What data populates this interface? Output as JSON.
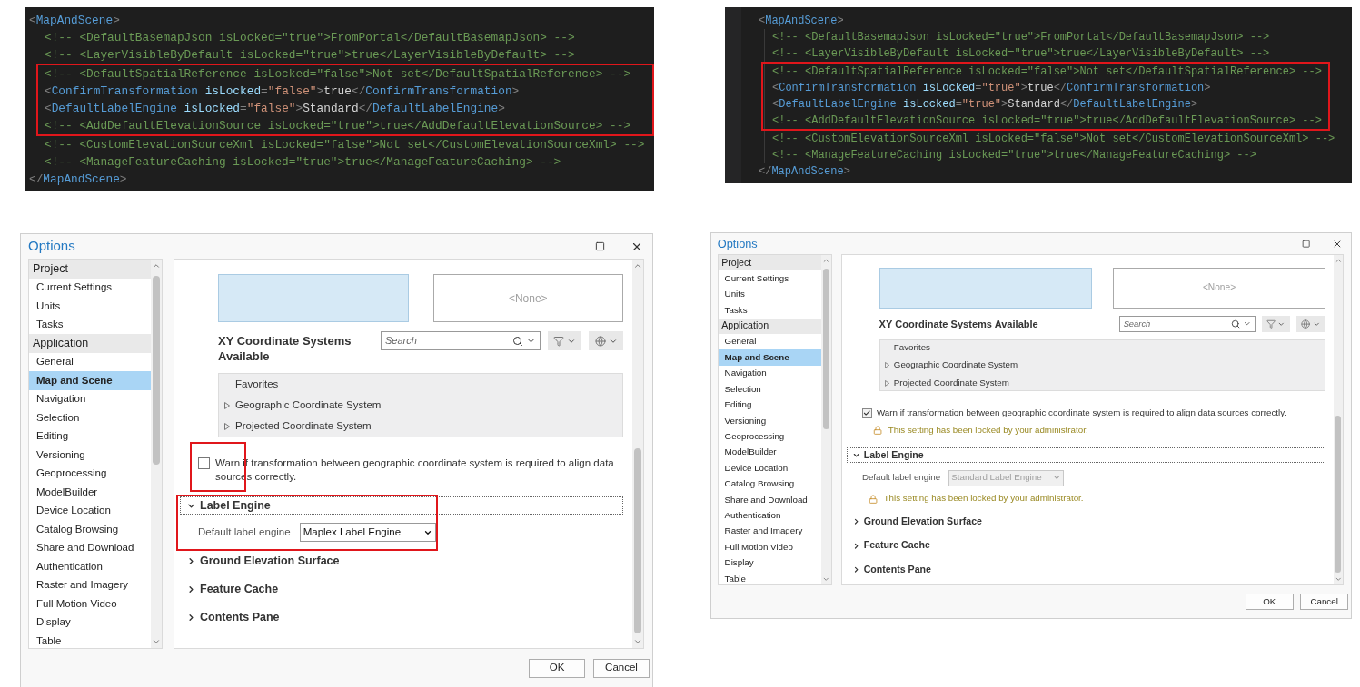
{
  "code_panels": [
    {
      "open": [
        {
          "kind": "punct",
          "text": "<"
        },
        {
          "kind": "tag",
          "text": "MapAndScene"
        },
        {
          "kind": "punct",
          "text": ">"
        }
      ],
      "children": [
        {
          "highlighted": false,
          "tokens": [
            {
              "kind": "comment",
              "text": "<!-- <DefaultBasemapJson isLocked=\"true\">FromPortal</DefaultBasemapJson> -->"
            }
          ]
        },
        {
          "highlighted": false,
          "tokens": [
            {
              "kind": "comment",
              "text": "<!-- <LayerVisibleByDefault isLocked=\"true\">true</LayerVisibleByDefault> -->"
            }
          ]
        },
        {
          "highlighted": true,
          "tokens": [
            {
              "kind": "comment",
              "text": "<!-- <DefaultSpatialReference isLocked=\"false\">Not set</DefaultSpatialReference> -->"
            }
          ]
        },
        {
          "highlighted": true,
          "tokens": [
            {
              "kind": "punct",
              "text": "<"
            },
            {
              "kind": "tag",
              "text": "ConfirmTransformation"
            },
            {
              "kind": "attr",
              "text": " isLocked"
            },
            {
              "kind": "punct",
              "text": "="
            },
            {
              "kind": "string",
              "text": "\"false\""
            },
            {
              "kind": "punct",
              "text": ">"
            },
            {
              "kind": "content",
              "text": "true"
            },
            {
              "kind": "punct",
              "text": "</"
            },
            {
              "kind": "tag",
              "text": "ConfirmTransformation"
            },
            {
              "kind": "punct",
              "text": ">"
            }
          ]
        },
        {
          "highlighted": true,
          "tokens": [
            {
              "kind": "punct",
              "text": "<"
            },
            {
              "kind": "tag",
              "text": "DefaultLabelEngine"
            },
            {
              "kind": "attr",
              "text": " isLocked"
            },
            {
              "kind": "punct",
              "text": "="
            },
            {
              "kind": "string",
              "text": "\"false\""
            },
            {
              "kind": "punct",
              "text": ">"
            },
            {
              "kind": "content",
              "text": "Standard"
            },
            {
              "kind": "punct",
              "text": "</"
            },
            {
              "kind": "tag",
              "text": "DefaultLabelEngine"
            },
            {
              "kind": "punct",
              "text": ">"
            }
          ]
        },
        {
          "highlighted": true,
          "tokens": [
            {
              "kind": "comment",
              "text": "<!-- <AddDefaultElevationSource isLocked=\"true\">true</AddDefaultElevationSource> -->"
            }
          ]
        },
        {
          "highlighted": false,
          "tokens": [
            {
              "kind": "comment",
              "text": "<!-- <CustomElevationSourceXml isLocked=\"false\">Not set</CustomElevationSourceXml> -->"
            }
          ]
        },
        {
          "highlighted": false,
          "tokens": [
            {
              "kind": "comment",
              "text": "<!-- <ManageFeatureCaching isLocked=\"true\">true</ManageFeatureCaching> -->"
            }
          ]
        }
      ],
      "close": [
        {
          "kind": "punct",
          "text": "</"
        },
        {
          "kind": "tag",
          "text": "MapAndScene"
        },
        {
          "kind": "punct",
          "text": ">"
        }
      ]
    },
    {
      "open": [
        {
          "kind": "punct",
          "text": "<"
        },
        {
          "kind": "tag",
          "text": "MapAndScene"
        },
        {
          "kind": "punct",
          "text": ">"
        }
      ],
      "children": [
        {
          "highlighted": false,
          "tokens": [
            {
              "kind": "comment",
              "text": "<!-- <DefaultBasemapJson isLocked=\"true\">FromPortal</DefaultBasemapJson> -->"
            }
          ]
        },
        {
          "highlighted": false,
          "tokens": [
            {
              "kind": "comment",
              "text": "<!-- <LayerVisibleByDefault isLocked=\"true\">true</LayerVisibleByDefault> -->"
            }
          ]
        },
        {
          "highlighted": true,
          "tokens": [
            {
              "kind": "comment",
              "text": "<!-- <DefaultSpatialReference isLocked=\"false\">Not set</DefaultSpatialReference> -->"
            }
          ]
        },
        {
          "highlighted": true,
          "tokens": [
            {
              "kind": "punct",
              "text": "<"
            },
            {
              "kind": "tag",
              "text": "ConfirmTransformation"
            },
            {
              "kind": "attr",
              "text": " isLocked"
            },
            {
              "kind": "punct",
              "text": "="
            },
            {
              "kind": "string",
              "text": "\"true\""
            },
            {
              "kind": "punct",
              "text": ">"
            },
            {
              "kind": "content",
              "text": "true"
            },
            {
              "kind": "punct",
              "text": "</"
            },
            {
              "kind": "tag",
              "text": "ConfirmTransformation"
            },
            {
              "kind": "punct",
              "text": ">"
            }
          ]
        },
        {
          "highlighted": true,
          "tokens": [
            {
              "kind": "punct",
              "text": "<"
            },
            {
              "kind": "tag",
              "text": "DefaultLabelEngine"
            },
            {
              "kind": "attr",
              "text": " isLocked"
            },
            {
              "kind": "punct",
              "text": "="
            },
            {
              "kind": "string",
              "text": "\"true\""
            },
            {
              "kind": "punct",
              "text": ">"
            },
            {
              "kind": "content",
              "text": "Standard"
            },
            {
              "kind": "punct",
              "text": "</"
            },
            {
              "kind": "tag",
              "text": "DefaultLabelEngine"
            },
            {
              "kind": "punct",
              "text": ">"
            }
          ]
        },
        {
          "highlighted": true,
          "tokens": [
            {
              "kind": "comment",
              "text": "<!-- <AddDefaultElevationSource isLocked=\"true\">true</AddDefaultElevationSource> -->"
            }
          ]
        },
        {
          "highlighted": false,
          "tokens": [
            {
              "kind": "comment",
              "text": "<!-- <CustomElevationSourceXml isLocked=\"false\">Not set</CustomElevationSourceXml> -->"
            }
          ]
        },
        {
          "highlighted": false,
          "tokens": [
            {
              "kind": "comment",
              "text": "<!-- <ManageFeatureCaching isLocked=\"true\">true</ManageFeatureCaching> -->"
            }
          ]
        }
      ],
      "close": [
        {
          "kind": "punct",
          "text": "</"
        },
        {
          "kind": "tag",
          "text": "MapAndScene"
        },
        {
          "kind": "punct",
          "text": ">"
        }
      ]
    }
  ],
  "dialogs": [
    {
      "title": "Options",
      "sidebar": [
        {
          "heading": "Project",
          "items": [
            {
              "label": "Current Settings",
              "selected": false
            },
            {
              "label": "Units",
              "selected": false
            },
            {
              "label": "Tasks",
              "selected": false
            }
          ]
        },
        {
          "heading": "Application",
          "items": [
            {
              "label": "General",
              "selected": false
            },
            {
              "label": "Map and Scene",
              "selected": true
            },
            {
              "label": "Navigation",
              "selected": false
            },
            {
              "label": "Selection",
              "selected": false
            },
            {
              "label": "Editing",
              "selected": false
            },
            {
              "label": "Versioning",
              "selected": false
            },
            {
              "label": "Geoprocessing",
              "selected": false
            },
            {
              "label": "ModelBuilder",
              "selected": false
            },
            {
              "label": "Device Location",
              "selected": false
            },
            {
              "label": "Catalog Browsing",
              "selected": false
            },
            {
              "label": "Share and Download",
              "selected": false
            },
            {
              "label": "Authentication",
              "selected": false
            },
            {
              "label": "Raster and Imagery",
              "selected": false
            },
            {
              "label": "Full Motion Video",
              "selected": false
            },
            {
              "label": "Display",
              "selected": false
            },
            {
              "label": "Table",
              "selected": false
            }
          ]
        }
      ],
      "current_z": "<None>",
      "available_heading": "XY Coordinate Systems Available",
      "search": {
        "placeholder": "Search"
      },
      "tree": [
        {
          "label": "Favorites",
          "expandable": false
        },
        {
          "label": "Geographic Coordinate System",
          "expandable": true
        },
        {
          "label": "Projected Coordinate System",
          "expandable": true
        }
      ],
      "transformation_warning": {
        "label": "Warn if transformation between geographic coordinate system is required to align data sources correctly.",
        "checked": false,
        "highlighted": true
      },
      "sections": [
        {
          "title": "Label Engine",
          "expanded": true,
          "focused": true,
          "highlighted": true,
          "field": {
            "label": "Default label engine",
            "value": "Maplex Label Engine",
            "disabled": false
          }
        },
        {
          "title": "Ground Elevation Surface",
          "expanded": false,
          "focused": false,
          "highlighted": false
        },
        {
          "title": "Feature Cache",
          "expanded": false,
          "focused": false,
          "highlighted": false
        },
        {
          "title": "Contents Pane",
          "expanded": false,
          "focused": false,
          "highlighted": false
        }
      ],
      "buttons": [
        "OK",
        "Cancel"
      ]
    },
    {
      "title": "Options",
      "sidebar": [
        {
          "heading": "Project",
          "items": [
            {
              "label": "Current Settings",
              "selected": false
            },
            {
              "label": "Units",
              "selected": false
            },
            {
              "label": "Tasks",
              "selected": false
            }
          ]
        },
        {
          "heading": "Application",
          "items": [
            {
              "label": "General",
              "selected": false
            },
            {
              "label": "Map and Scene",
              "selected": true
            },
            {
              "label": "Navigation",
              "selected": false
            },
            {
              "label": "Selection",
              "selected": false
            },
            {
              "label": "Editing",
              "selected": false
            },
            {
              "label": "Versioning",
              "selected": false
            },
            {
              "label": "Geoprocessing",
              "selected": false
            },
            {
              "label": "ModelBuilder",
              "selected": false
            },
            {
              "label": "Device Location",
              "selected": false
            },
            {
              "label": "Catalog Browsing",
              "selected": false
            },
            {
              "label": "Share and Download",
              "selected": false
            },
            {
              "label": "Authentication",
              "selected": false
            },
            {
              "label": "Raster and Imagery",
              "selected": false
            },
            {
              "label": "Full Motion Video",
              "selected": false
            },
            {
              "label": "Display",
              "selected": false
            },
            {
              "label": "Table",
              "selected": false
            }
          ]
        }
      ],
      "current_z": "<None>",
      "available_heading": "XY Coordinate Systems Available",
      "search": {
        "placeholder": "Search"
      },
      "tree": [
        {
          "label": "Favorites",
          "expandable": false
        },
        {
          "label": "Geographic Coordinate System",
          "expandable": true
        },
        {
          "label": "Projected Coordinate System",
          "expandable": true
        }
      ],
      "transformation_warning": {
        "label": "Warn if transformation between geographic coordinate system is required to align data sources correctly.",
        "checked": true,
        "highlighted": false,
        "locked_note": "This setting has been locked by your administrator."
      },
      "sections": [
        {
          "title": "Label Engine",
          "expanded": true,
          "focused": true,
          "highlighted": false,
          "field": {
            "label": "Default label engine",
            "value": "Standard Label Engine",
            "disabled": true
          },
          "locked_note": "This setting has been locked by your administrator."
        },
        {
          "title": "Ground Elevation Surface",
          "expanded": false,
          "focused": false,
          "highlighted": false
        },
        {
          "title": "Feature Cache",
          "expanded": false,
          "focused": false,
          "highlighted": false
        },
        {
          "title": "Contents Pane",
          "expanded": false,
          "focused": false,
          "highlighted": false
        }
      ],
      "buttons": [
        "OK",
        "Cancel"
      ]
    }
  ]
}
